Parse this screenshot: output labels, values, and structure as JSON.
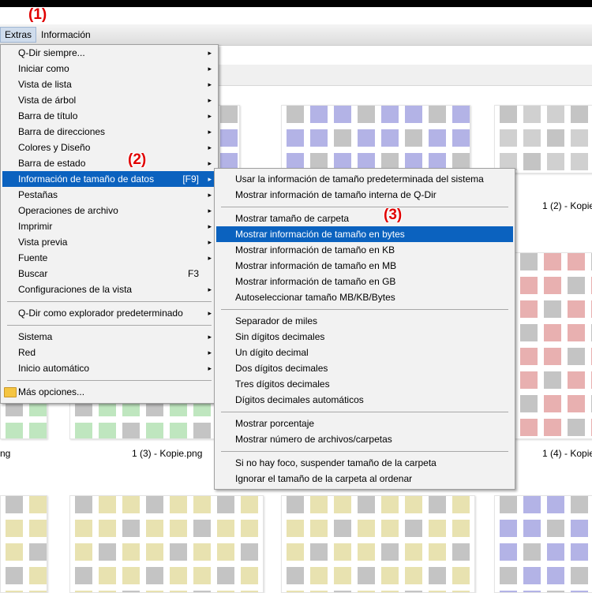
{
  "menubar": {
    "extras": "Extras",
    "info": "Información"
  },
  "callouts": {
    "c1": "(1)",
    "c2": "(2)",
    "c3": "(3)"
  },
  "captions": {
    "r1b": "1 (2) - Kopie",
    "r2left": "ng",
    "r2mid": "1 (3) - Kopie.png",
    "r2right": "1 (4) - Kopie"
  },
  "main_menu": {
    "items": [
      {
        "label": "Q-Dir siempre...",
        "arrow": "▸"
      },
      {
        "label": "Iniciar como",
        "arrow": "▸"
      },
      {
        "label": "Vista de lista",
        "arrow": "▸"
      },
      {
        "label": "Vista de árbol",
        "arrow": "▸"
      },
      {
        "label": "Barra de título",
        "arrow": "▸"
      },
      {
        "label": "Barra de direcciones",
        "arrow": "▸"
      },
      {
        "label": "Colores y Diseño",
        "arrow": "▸"
      },
      {
        "label": "Barra de estado",
        "arrow": "▸"
      },
      {
        "label": "Información de tamaño de datos",
        "shortcut": "[F9]",
        "arrow": "▸"
      },
      {
        "label": "Pestañas",
        "arrow": "▸"
      },
      {
        "label": "Operaciones de archivo",
        "arrow": "▸"
      },
      {
        "label": "Imprimir",
        "arrow": "▸"
      },
      {
        "label": "Vista previa",
        "arrow": "▸"
      },
      {
        "label": "Fuente",
        "arrow": "▸"
      },
      {
        "label": "Buscar",
        "shortcut": "F3",
        "arrow": "▸"
      },
      {
        "label": "Configuraciones de la vista",
        "arrow": "▸"
      },
      {
        "label": "Q-Dir como explorador predeterminado",
        "arrow": "▸"
      },
      {
        "label": "Sistema",
        "arrow": "▸"
      },
      {
        "label": "Red",
        "arrow": "▸"
      },
      {
        "label": "Inicio automático",
        "arrow": "▸"
      },
      {
        "label": "Más opciones..."
      }
    ]
  },
  "sub_menu": {
    "items": [
      "Usar la información de tamaño predeterminada del sistema",
      "Mostrar información de tamaño interna de Q-Dir",
      "Mostrar tamaño de carpeta",
      "Mostrar información de tamaño en bytes",
      "Mostrar información de tamaño en KB",
      "Mostrar información de tamaño en MB",
      "Mostrar información de tamaño en GB",
      "Autoseleccionar tamaño MB/KB/Bytes",
      "Separador de miles",
      "Sin dígitos decimales",
      "Un dígito decimal",
      "Dos dígitos decimales",
      "Tres dígitos decimales",
      "Dígitos decimales automáticos",
      "Mostrar porcentaje",
      "Mostrar número de archivos/carpetas",
      "Si no hay foco, suspender tamaño de la carpeta",
      "Ignorar el tamaño de la carpeta al ordenar"
    ]
  },
  "colors": {
    "highlight": "#0b62bf",
    "callout": "#e00000",
    "purple": "#b3b3e6",
    "gray": "#d0d0d0",
    "pink": "#e8b0b0",
    "green": "#bfe6bf",
    "yellow": "#e8e2b0"
  }
}
